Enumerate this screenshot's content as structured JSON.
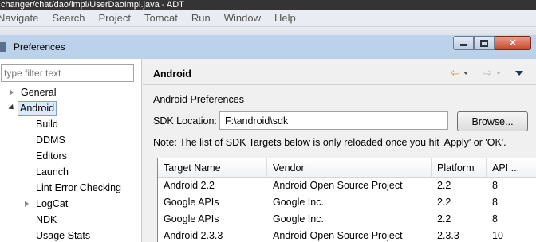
{
  "background_window": {
    "title": "changer/chat/dao/impl/UserDaoImpl.java - ADT",
    "menu": [
      "Navigate",
      "Search",
      "Project",
      "Tomcat",
      "Run",
      "Window",
      "Help"
    ]
  },
  "dialog": {
    "title": "Preferences",
    "window_controls": {
      "close_glyph": "✕"
    }
  },
  "filter": {
    "placeholder": "type filter text"
  },
  "tree": [
    {
      "label": "General",
      "expander": "closed"
    },
    {
      "label": "Android",
      "expander": "open",
      "selected": true
    },
    {
      "label": "Build"
    },
    {
      "label": "DDMS"
    },
    {
      "label": "Editors"
    },
    {
      "label": "Launch"
    },
    {
      "label": "Lint Error Checking"
    },
    {
      "label": "LogCat",
      "expander": "closed"
    },
    {
      "label": "NDK"
    },
    {
      "label": "Usage Stats"
    }
  ],
  "page": {
    "title": "Android",
    "nav": {
      "back_icon": "back-arrow-icon",
      "forward_icon": "forward-arrow-icon",
      "view_menu_icon": "view-menu-icon"
    },
    "heading": "Android Preferences",
    "sdk_label": "SDK Location:",
    "sdk_value": "F:\\android\\sdk",
    "browse_label": "Browse...",
    "note": "Note: The list of SDK Targets below is only reloaded once you hit 'Apply' or 'OK'."
  },
  "targets_table": {
    "columns": [
      "Target Name",
      "Vendor",
      "Platform",
      "API ..."
    ],
    "rows": [
      [
        "Android 2.2",
        "Android Open Source Project",
        "2.2",
        "8"
      ],
      [
        "Google APIs",
        "Google Inc.",
        "2.2",
        "8"
      ],
      [
        "Google APIs",
        "Google Inc.",
        "2.2",
        "8"
      ],
      [
        "Android 2.3.3",
        "Android Open Source Project",
        "2.3.3",
        "10"
      ]
    ]
  },
  "colors": {
    "accent": "#d79a12",
    "selection": "#dceaf8",
    "dialog_frame": "#bcd3eb",
    "close_button": "#c9462a"
  }
}
